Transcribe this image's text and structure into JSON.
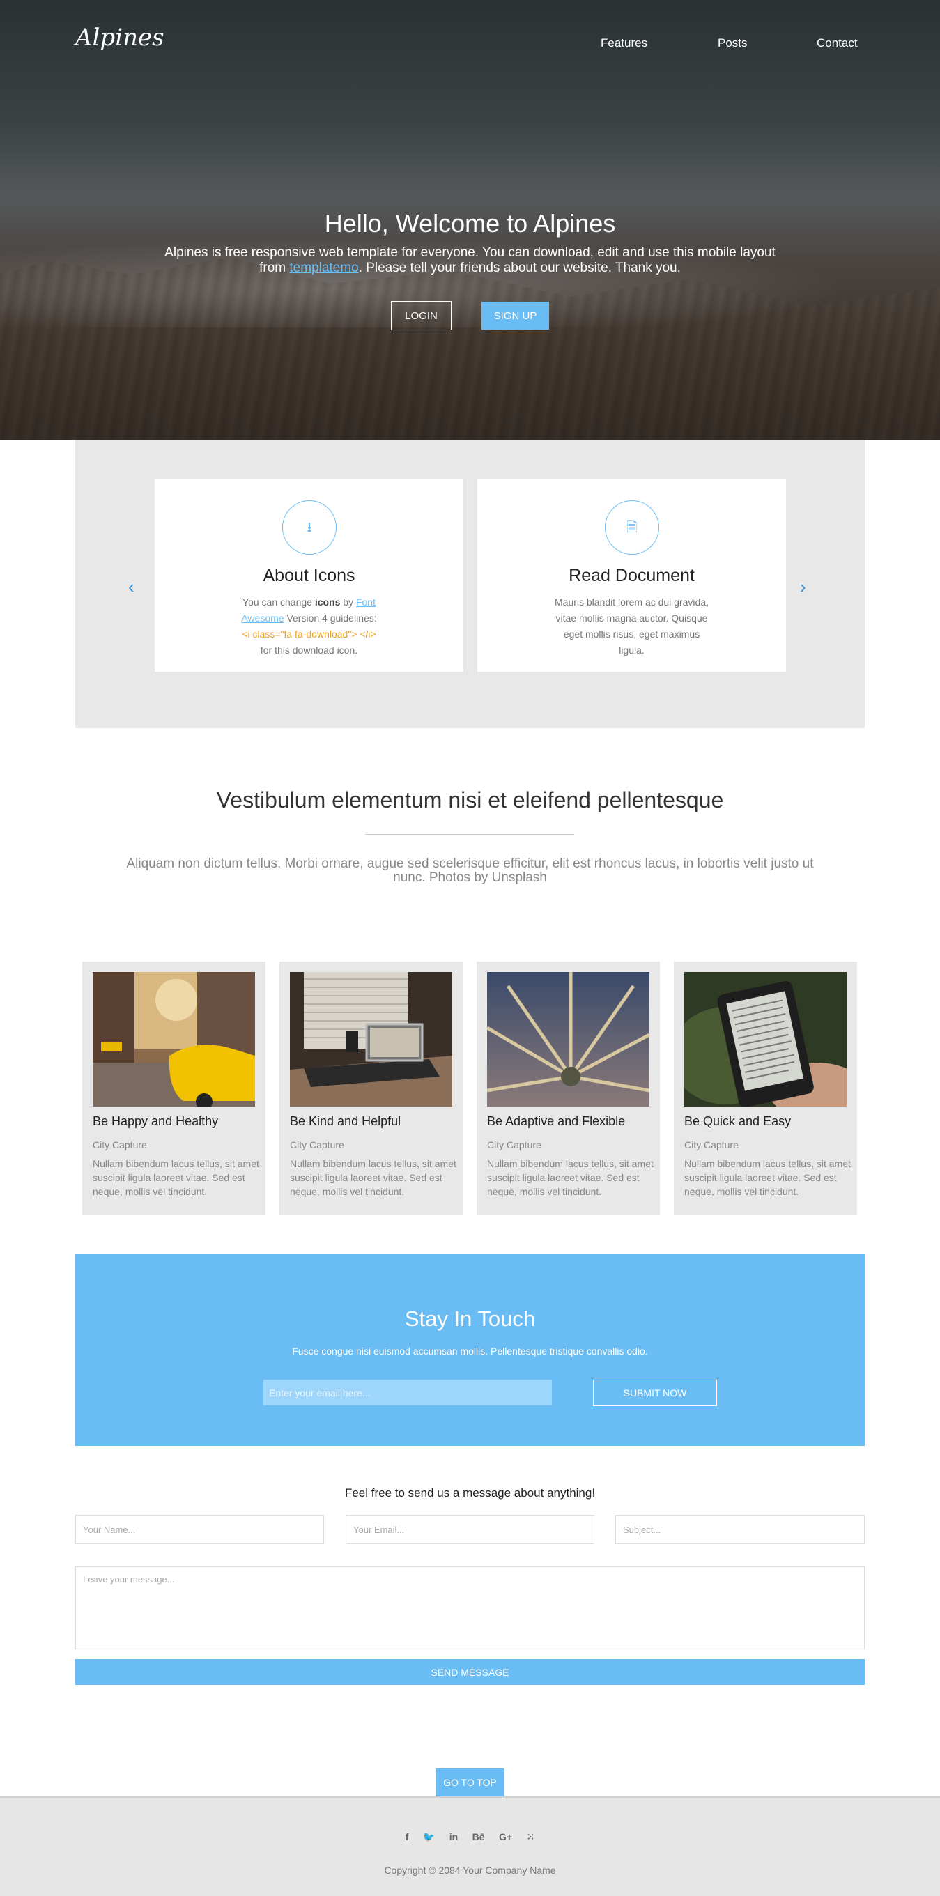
{
  "header": {
    "logo": "Alpines",
    "nav": [
      "Features",
      "Posts",
      "Contact"
    ]
  },
  "hero": {
    "title": "Hello, Welcome to Alpines",
    "subtitle_line1": "Alpines is free responsive web template for everyone. You can download, edit and use this mobile layout",
    "subtitle_from": "from ",
    "subtitle_link": "templatemo",
    "subtitle_rest": ". Please tell your friends about our website. Thank you.",
    "login_label": "LOGIN",
    "signup_label": "SIGN UP"
  },
  "carousel": {
    "cards": [
      {
        "icon": "download-icon",
        "title": "About Icons",
        "text_1": "You can change ",
        "text_bold": "icons",
        "text_2": " by ",
        "text_link": "Font Awesome",
        "text_3": " Version 4 guidelines:",
        "text_code": "<i class=\"fa fa-download\"> </i>",
        "text_4": "for this download icon."
      },
      {
        "icon": "document-icon",
        "title": "Read Document",
        "text": "Mauris blandit lorem ac dui gravida, vitae mollis magna auctor. Quisque eget mollis risus, eget maximus ligula."
      }
    ]
  },
  "intro": {
    "title": "Vestibulum elementum nisi et eleifend pellentesque",
    "text": "Aliquam non dictum tellus. Morbi ornare, augue sed scelerisque efficitur, elit est rhoncus lacus, in lobortis velit justo ut nunc. Photos by Unsplash"
  },
  "gallery": [
    {
      "title": "Be Happy and Healthy",
      "caption": "City Capture",
      "text": "Nullam bibendum lacus tellus, sit amet suscipit ligula laoreet vitae. Sed est neque, mollis vel tincidunt."
    },
    {
      "title": "Be Kind and Helpful",
      "caption": "City Capture",
      "text": "Nullam bibendum lacus tellus, sit amet suscipit ligula laoreet vitae. Sed est neque, mollis vel tincidunt."
    },
    {
      "title": "Be Adaptive and Flexible",
      "caption": "City Capture",
      "text": "Nullam bibendum lacus tellus, sit amet suscipit ligula laoreet vitae. Sed est neque, mollis vel tincidunt."
    },
    {
      "title": "Be Quick and Easy",
      "caption": "City Capture",
      "text": "Nullam bibendum lacus tellus, sit amet suscipit ligula laoreet vitae. Sed est neque, mollis vel tincidunt."
    }
  ],
  "newsletter": {
    "title": "Stay In Touch",
    "description": "Fusce congue nisi euismod accumsan mollis. Pellentesque tristique convallis odio.",
    "email_placeholder": "Enter your email here...",
    "submit_label": "SUBMIT NOW"
  },
  "contact": {
    "title": "Feel free to send us a message about anything!",
    "name_placeholder": "Your Name...",
    "email_placeholder": "Your Email...",
    "subject_placeholder": "Subject...",
    "message_placeholder": "Leave your message...",
    "send_label": "SEND MESSAGE"
  },
  "footer": {
    "go_top_label": "GO TO TOP",
    "social": [
      {
        "icon": "facebook-icon",
        "glyph": "f"
      },
      {
        "icon": "twitter-icon",
        "glyph": "🐦"
      },
      {
        "icon": "linkedin-icon",
        "glyph": "in"
      },
      {
        "icon": "behance-icon",
        "glyph": "Bē"
      },
      {
        "icon": "google-plus-icon",
        "glyph": "G+"
      },
      {
        "icon": "rss-icon",
        "glyph": "⁙"
      }
    ],
    "copyright": "Copyright © 2084 Your Company Name"
  },
  "colors": {
    "accent": "#69bdf4",
    "panel_gray": "#e8e8e8",
    "footer_gray": "#e6e6e6"
  }
}
